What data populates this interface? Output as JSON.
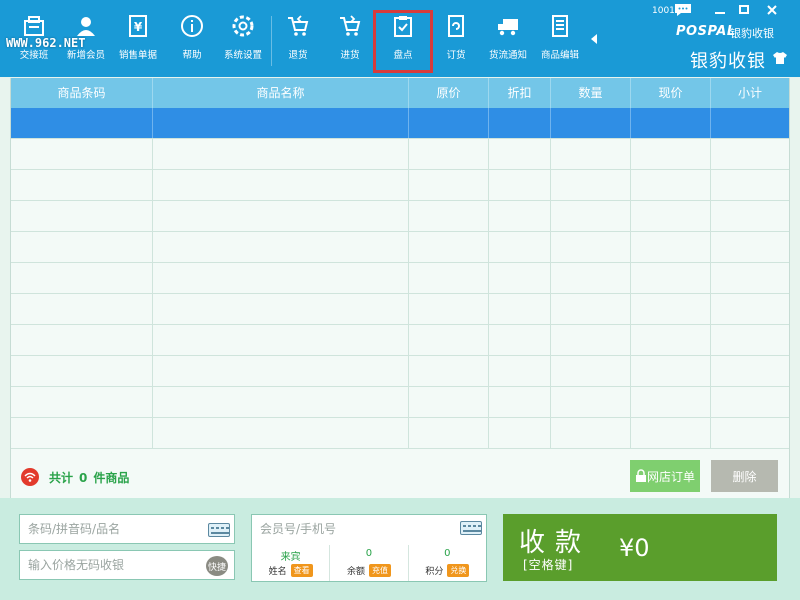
{
  "watermark": "WWW.962.NET",
  "toolbar": {
    "items": [
      {
        "label": "交接班",
        "icon": "shift-icon"
      },
      {
        "label": "新增会员",
        "icon": "add-member-icon"
      },
      {
        "label": "销售单据",
        "icon": "sales-receipt-icon"
      },
      {
        "label": "帮助",
        "icon": "help-icon"
      },
      {
        "label": "系统设置",
        "icon": "settings-icon"
      },
      {
        "label": "退货",
        "icon": "return-cart-icon"
      },
      {
        "label": "进货",
        "icon": "purchase-cart-icon"
      },
      {
        "label": "盘点",
        "icon": "inventory-check-icon"
      },
      {
        "label": "订货",
        "icon": "order-icon"
      },
      {
        "label": "货流通知",
        "icon": "truck-icon"
      },
      {
        "label": "商品编辑",
        "icon": "product-edit-icon"
      }
    ]
  },
  "header": {
    "user_number": "1001",
    "brand_en": "POSPAL",
    "brand_cn_small": "银豹收银",
    "brand_cn": "银豹收银"
  },
  "table": {
    "columns": [
      "商品条码",
      "商品名称",
      "原价",
      "折扣",
      "数量",
      "现价",
      "小计"
    ],
    "row_count": 11
  },
  "summary": {
    "total_prefix": "共计",
    "total_count": "0",
    "total_suffix": "件商品",
    "online_order_label": "网店订单",
    "delete_label": "删除"
  },
  "inputs": {
    "barcode_placeholder": "条码/拼音码/品名",
    "noprice_placeholder": "输入价格无码收银",
    "quick_label": "快捷"
  },
  "member": {
    "placeholder": "会员号/手机号",
    "name_value": "来宾",
    "name_label": "姓名",
    "name_action": "查看",
    "balance_value": "0",
    "balance_label": "余额",
    "balance_action": "充值",
    "points_value": "0",
    "points_label": "积分",
    "points_action": "兑换"
  },
  "pay": {
    "label": "收款",
    "shortcut": "[空格键]",
    "amount": "¥0"
  },
  "colors": {
    "toolbar": "#1a9ad6",
    "table_header": "#73c6e8",
    "selected_row": "#2f8ee5",
    "pay_button": "#5a9e2c",
    "online_order_button": "#7fcf6f",
    "delete_button": "#b6b9b0",
    "highlight": "#d83b3b"
  }
}
